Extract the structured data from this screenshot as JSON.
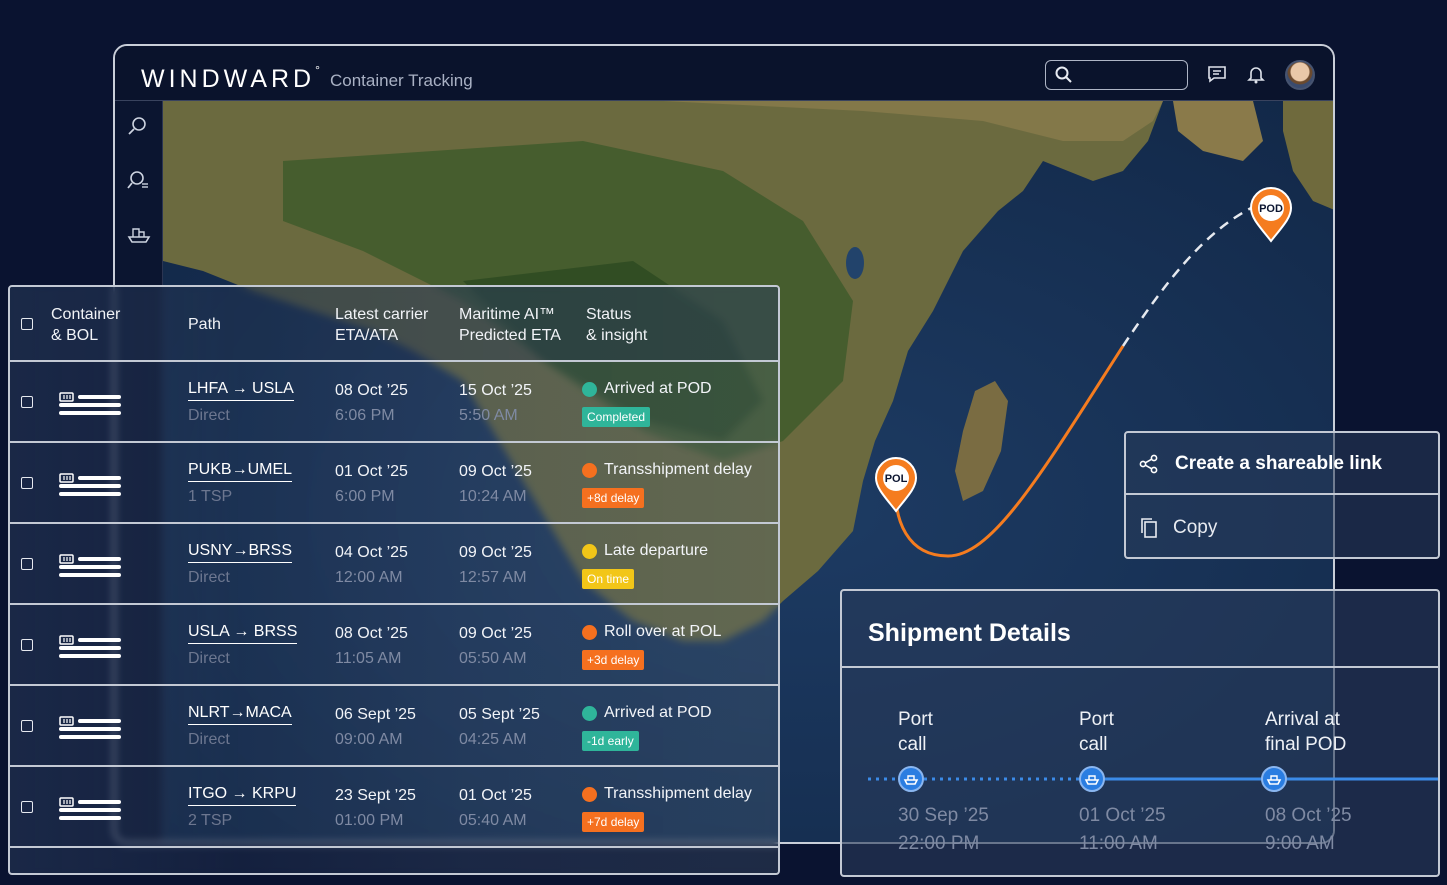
{
  "app": {
    "brand": "WINDWARD",
    "brand_mark": "°",
    "title": "Container Tracking"
  },
  "map": {
    "pol_label": "POL",
    "pod_label": "POD",
    "route_color": "#f57c1f"
  },
  "table": {
    "headers": {
      "container": "Container\n& BOL",
      "path": "Path",
      "carrier_eta": "Latest carrier\nETA/ATA",
      "ai_eta": "Maritime AI™\nPredicted ETA",
      "status": "Status\n& insight"
    },
    "rows": [
      {
        "path": "LHFA → USLA",
        "path_sub": "Direct",
        "carrier_date": "08 Oct ’25",
        "carrier_time": "6:06 PM",
        "ai_date": "15 Oct ’25",
        "ai_time": "5:50 AM",
        "status": "Arrived at POD",
        "badge": "Completed",
        "badge_color": "#2fb59a",
        "dot_color": "#2fb59a"
      },
      {
        "path": "PUKB→UMEL",
        "path_sub": "1 TSP",
        "carrier_date": "01 Oct ’25",
        "carrier_time": "6:00 PM",
        "ai_date": "09 Oct ’25",
        "ai_time": "10:24 AM",
        "status": "Transshipment delay",
        "badge": "+8d delay",
        "badge_color": "#f5701f",
        "dot_color": "#f5701f"
      },
      {
        "path": "USNY→BRSS",
        "path_sub": "Direct",
        "carrier_date": "04 Oct ’25",
        "carrier_time": "12:00 AM",
        "ai_date": "09 Oct ’25",
        "ai_time": "12:57 AM",
        "status": "Late departure",
        "badge": "On time",
        "badge_color": "#f2c618",
        "dot_color": "#f2c618"
      },
      {
        "path": "USLA → BRSS",
        "path_sub": "Direct",
        "carrier_date": "08 Oct ’25",
        "carrier_time": "11:05 AM",
        "ai_date": "09 Oct ’25",
        "ai_time": "05:50 AM",
        "status": "Roll over at POL",
        "badge": "+3d delay",
        "badge_color": "#f5701f",
        "dot_color": "#f5701f"
      },
      {
        "path": "NLRT→MACA",
        "path_sub": "Direct",
        "carrier_date": "06 Sept ’25",
        "carrier_time": "09:00 AM",
        "ai_date": "05 Sept ’25",
        "ai_time": "04:25 AM",
        "status": "Arrived at POD",
        "badge": "-1d early",
        "badge_color": "#2fb59a",
        "dot_color": "#2fb59a"
      },
      {
        "path": "ITGO → KRPU",
        "path_sub": "2 TSP",
        "carrier_date": "23 Sept ’25",
        "carrier_time": "01:00 PM",
        "ai_date": "01 Oct ’25",
        "ai_time": "05:40 AM",
        "status": "Transshipment delay",
        "badge": "+7d delay",
        "badge_color": "#f5701f",
        "dot_color": "#f5701f"
      }
    ]
  },
  "share": {
    "create_label": "Create a shareable link",
    "copy_label": "Copy"
  },
  "details": {
    "title": "Shipment Details",
    "stops": [
      {
        "label": "Port\ncall",
        "date": "30 Sep ’25",
        "time": "22:00 PM"
      },
      {
        "label": "Port\ncall",
        "date": "01 Oct ’25",
        "time": "11:00 AM"
      },
      {
        "label": "Arrival at\nfinal POD",
        "date": "08 Oct ’25",
        "time": "9:00 AM"
      }
    ]
  },
  "icons": {
    "search": "search-icon",
    "messages": "chat-icon",
    "notifications": "bell-icon",
    "share": "share-icon",
    "copy": "copy-icon"
  }
}
